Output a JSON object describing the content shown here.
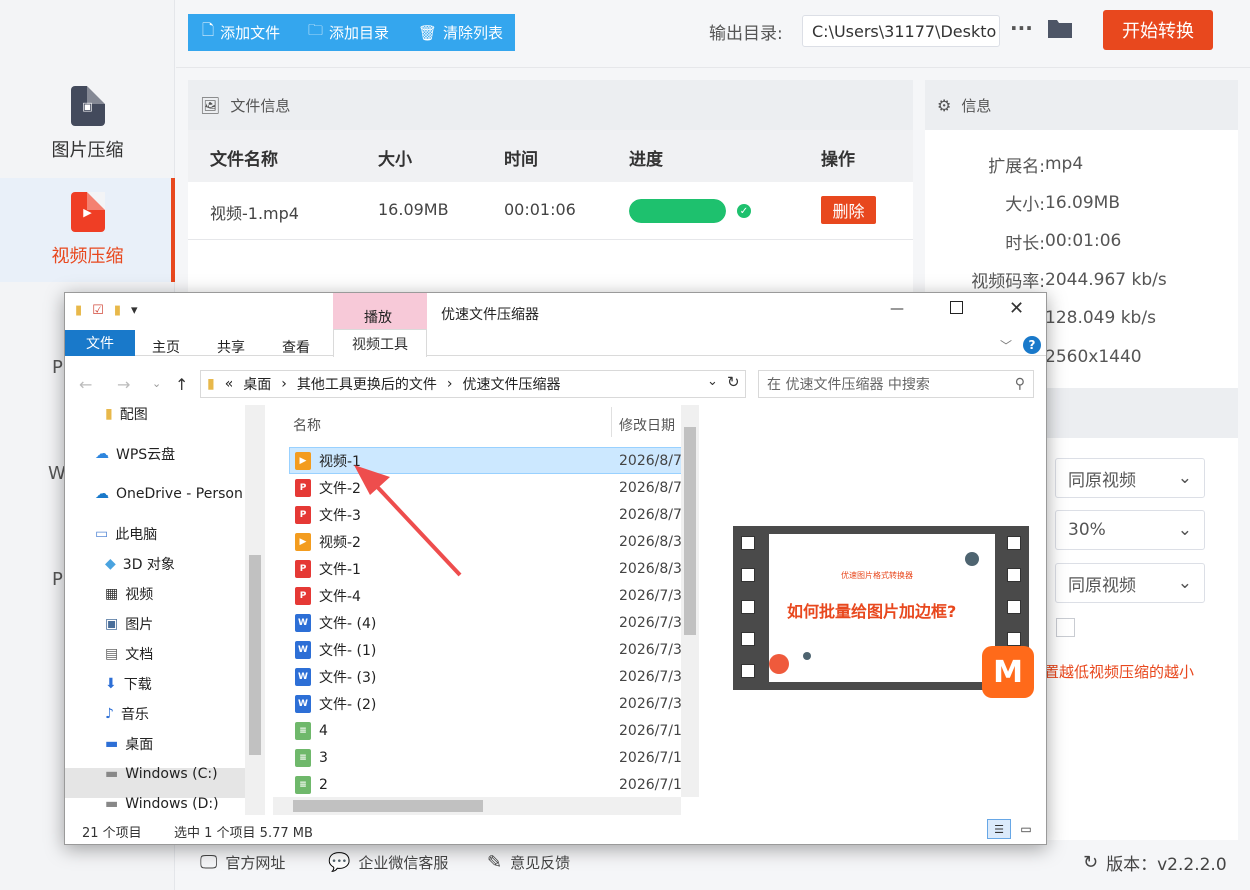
{
  "sidebar": {
    "items": [
      {
        "label": "图片压缩",
        "icon": "image-file-icon"
      },
      {
        "label": "视频压缩",
        "icon": "video-file-icon"
      }
    ]
  },
  "toolbar": {
    "add_file": "添加文件",
    "add_dir": "添加目录",
    "clear_list": "清除列表",
    "output_label": "输出目录:",
    "output_path": "C:\\Users\\31177\\Deskto",
    "more": "···",
    "start": "开始转换"
  },
  "file_panel": {
    "title": "文件信息",
    "headers": [
      "文件名称",
      "大小",
      "时间",
      "进度",
      "操作"
    ],
    "rows": [
      {
        "name": "视频-1.mp4",
        "size": "16.09MB",
        "time": "00:01:06",
        "progress": 1.0,
        "action": "删除"
      }
    ]
  },
  "info_panel": {
    "title": "信息",
    "rows": [
      {
        "k": "扩展名:",
        "v": "mp4"
      },
      {
        "k": "大小:",
        "v": "16.09MB"
      },
      {
        "k": "时长:",
        "v": "00:01:06"
      },
      {
        "k": "视频码率:",
        "v": "2044.967 kb/s"
      },
      {
        "k": "",
        "v": "128.049 kb/s"
      },
      {
        "k": "",
        "v": "2560x1440"
      }
    ]
  },
  "settings": {
    "selects": [
      "同原视频",
      "30%",
      "同原视频"
    ],
    "note": "置越低视频压缩的越小"
  },
  "left_partial_letters": [
    "P",
    "W",
    "P"
  ],
  "footer": {
    "site": "官方网址",
    "wechat": "企业微信客服",
    "feedback": "意见反馈",
    "version": "版本：v2.2.2.0"
  },
  "explorer": {
    "title": "优速文件压缩器",
    "context_tab": "播放",
    "tabs": [
      "文件",
      "主页",
      "共享",
      "查看",
      "视频工具"
    ],
    "address": [
      "«",
      "桌面",
      "其他工具更换后的文件",
      "优速文件压缩器"
    ],
    "search_placeholder": "在 优速文件压缩器 中搜索",
    "tree": [
      {
        "label": "配图",
        "icon": "folder-icon"
      },
      {
        "label": "WPS云盘",
        "icon": "cloud-icon"
      },
      {
        "label": "OneDrive - Person",
        "icon": "onedrive-icon"
      },
      {
        "label": "此电脑",
        "icon": "computer-icon"
      },
      {
        "label": "3D 对象",
        "icon": "cube-icon"
      },
      {
        "label": "视频",
        "icon": "film-icon"
      },
      {
        "label": "图片",
        "icon": "picture-icon"
      },
      {
        "label": "文档",
        "icon": "document-icon"
      },
      {
        "label": "下载",
        "icon": "download-icon"
      },
      {
        "label": "音乐",
        "icon": "music-icon"
      },
      {
        "label": "桌面",
        "icon": "desktop-icon"
      },
      {
        "label": "Windows (C:)",
        "icon": "drive-icon"
      },
      {
        "label": "Windows (D:)",
        "icon": "drive-icon"
      }
    ],
    "columns": [
      "名称",
      "修改日期"
    ],
    "files": [
      {
        "name": "视频-1",
        "date": "2026/8/7",
        "type": "vid"
      },
      {
        "name": "文件-2",
        "date": "2026/8/7",
        "type": "pdf"
      },
      {
        "name": "文件-3",
        "date": "2026/8/7",
        "type": "pdf"
      },
      {
        "name": "视频-2",
        "date": "2026/8/3",
        "type": "vid"
      },
      {
        "name": "文件-1",
        "date": "2026/8/3",
        "type": "pdf"
      },
      {
        "name": "文件-4",
        "date": "2026/7/3",
        "type": "pdf"
      },
      {
        "name": "文件- (4)",
        "date": "2026/7/3",
        "type": "doc"
      },
      {
        "name": "文件- (1)",
        "date": "2026/7/3",
        "type": "doc"
      },
      {
        "name": "文件- (3)",
        "date": "2026/7/3",
        "type": "doc"
      },
      {
        "name": "文件- (2)",
        "date": "2026/7/3",
        "type": "doc"
      },
      {
        "name": "4",
        "date": "2026/7/1",
        "type": "txt"
      },
      {
        "name": "3",
        "date": "2026/7/1",
        "type": "txt"
      },
      {
        "name": "2",
        "date": "2026/7/1",
        "type": "txt"
      }
    ],
    "preview": {
      "brand": "优速图片格式转换器",
      "headline": "如何批量给图片加边框?"
    },
    "status": {
      "count": "21 个项目",
      "selected": "选中 1 个项目  5.77 MB"
    }
  },
  "colors": {
    "accent_orange": "#e8481e",
    "toolbar_blue": "#34a6ee",
    "progress_green": "#1ec16e",
    "ribbon_blue": "#1979ca"
  }
}
